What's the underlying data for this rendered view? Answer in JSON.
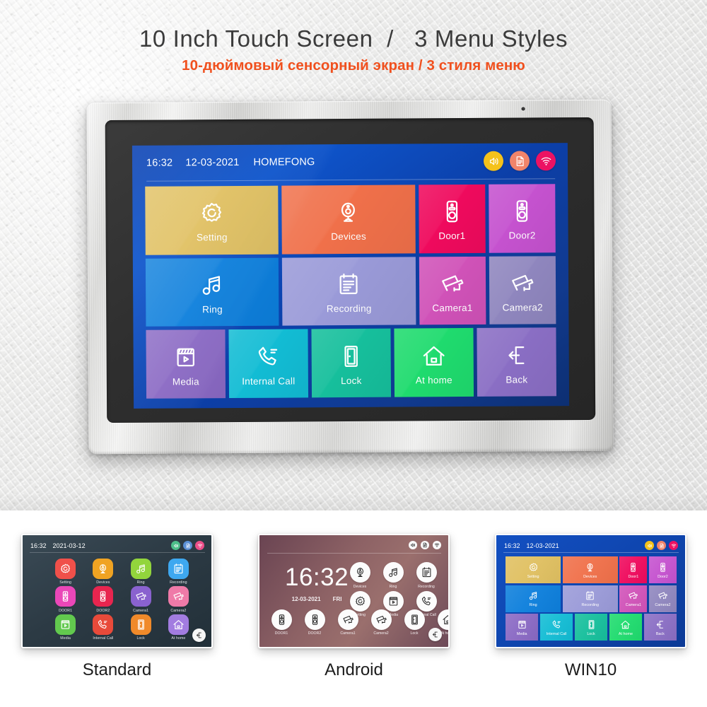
{
  "headline": {
    "english": "10 Inch Touch Screen  /   3 Menu Styles",
    "russian": "10-дюймовый сенсорный экран / 3 стиля меню",
    "english_color": "#3b3b3b",
    "russian_color": "#f0501e"
  },
  "main_screen": {
    "statusbar": {
      "time": "16:32",
      "date": "12-03-2021",
      "brand": "HOMEFONG",
      "icons": [
        {
          "name": "volume-icon",
          "color": "#f5c21b"
        },
        {
          "name": "document-icon",
          "color": "#f0846a"
        },
        {
          "name": "wifi-icon",
          "color": "#ec1263"
        }
      ]
    },
    "tiles": [
      {
        "label": "Setting",
        "icon": "gear-icon",
        "color": "#e0c061",
        "flex": 2
      },
      {
        "label": "Devices",
        "icon": "webcam-icon",
        "color": "#f0704a",
        "flex": 2
      },
      {
        "label": "Door1",
        "icon": "doorbell-icon",
        "color": "#ef0a5d",
        "flex": 1
      },
      {
        "label": "Door2",
        "icon": "doorbell-icon",
        "color": "#c552cf",
        "flex": 1
      },
      {
        "label": "Ring",
        "icon": "music-note-icon",
        "color": "#0d7fdc",
        "flex": 2
      },
      {
        "label": "Recording",
        "icon": "clipboard-icon",
        "color": "#9a9ad8",
        "flex": 2
      },
      {
        "label": "Camera1",
        "icon": "cctv-icon",
        "color": "#d052b8",
        "flex": 1
      },
      {
        "label": "Camera2",
        "icon": "cctv-icon",
        "color": "#8f86be",
        "flex": 1
      },
      {
        "label": "Media",
        "icon": "media-icon",
        "color": "#8a69c4",
        "flex": 1
      },
      {
        "label": "Internal Call",
        "icon": "phone-call-icon",
        "color": "#12bcd4",
        "flex": 1
      },
      {
        "label": "Lock",
        "icon": "door-icon",
        "color": "#16bf9c",
        "flex": 1
      },
      {
        "label": "At home",
        "icon": "home-icon",
        "color": "#1fdb6e",
        "flex": 1
      },
      {
        "label": "Back",
        "icon": "back-arrow-icon",
        "color": "#8a6ec4",
        "flex": 1
      }
    ]
  },
  "variants": [
    {
      "caption": "Standard",
      "statusbar": {
        "time": "16:32",
        "date": "2021-03-12"
      },
      "status_icons": [
        {
          "name": "volume-icon",
          "color": "#4dbf8a"
        },
        {
          "name": "document-icon",
          "color": "#5a8fd6"
        },
        {
          "name": "wifi-icon",
          "color": "#ec4e89"
        }
      ],
      "tiles": [
        {
          "label": "Setting",
          "icon": "gear-icon",
          "color": "#f0504a"
        },
        {
          "label": "Devices",
          "icon": "webcam-icon",
          "color": "#f0a322"
        },
        {
          "label": "Ring",
          "icon": "music-note-icon",
          "color": "#92d53c"
        },
        {
          "label": "Recording",
          "icon": "clipboard-icon",
          "color": "#3ea8f0"
        },
        {
          "label": "DOOR1",
          "icon": "doorbell-icon",
          "color": "#ea47b8"
        },
        {
          "label": "DOOR2",
          "icon": "doorbell-icon",
          "color": "#e8254f"
        },
        {
          "label": "Camera1",
          "icon": "cctv-icon",
          "color": "#8a62cf"
        },
        {
          "label": "Camera2",
          "icon": "cctv-icon",
          "color": "#ef7aa8"
        },
        {
          "label": "Media",
          "icon": "media-icon",
          "color": "#62c94e"
        },
        {
          "label": "Internal Call",
          "icon": "phone-call-icon",
          "color": "#e84a3a"
        },
        {
          "label": "Lock",
          "icon": "door-icon",
          "color": "#f08a2a"
        },
        {
          "label": "At home",
          "icon": "home-icon",
          "color": "#a27ce0"
        }
      ],
      "back_button": "back-arrow-icon"
    },
    {
      "caption": "Android",
      "clock": {
        "time": "16:32",
        "date": "12-03-2021",
        "weekday": "FRI"
      },
      "status_icons": [
        {
          "name": "volume-icon"
        },
        {
          "name": "document-icon"
        },
        {
          "name": "wifi-icon"
        }
      ],
      "tiles_right_row1": [
        {
          "label": "Devices",
          "icon": "webcam-icon"
        },
        {
          "label": "Ring",
          "icon": "music-note-icon"
        },
        {
          "label": "Recording",
          "icon": "clipboard-icon"
        }
      ],
      "tiles_right_row2": [
        {
          "label": "Setting",
          "icon": "gear-icon"
        },
        {
          "label": "Media",
          "icon": "media-icon"
        },
        {
          "label": "Internal Call",
          "icon": "phone-call-icon"
        }
      ],
      "tiles_bottom": [
        {
          "label": "DOOR1",
          "icon": "doorbell-icon"
        },
        {
          "label": "DOOR2",
          "icon": "doorbell-icon"
        },
        {
          "label": "Camera1",
          "icon": "cctv-icon"
        },
        {
          "label": "Camera2",
          "icon": "cctv-icon"
        },
        {
          "label": "Lock",
          "icon": "door-icon"
        },
        {
          "label": "At home",
          "icon": "home-icon"
        }
      ],
      "back_button": "back-arrow-icon"
    },
    {
      "caption": "WIN10",
      "statusbar": {
        "time": "16:32",
        "date": "12-03-2021"
      },
      "status_icons": [
        {
          "name": "volume-icon",
          "color": "#f5c21b"
        },
        {
          "name": "document-icon",
          "color": "#f0846a"
        },
        {
          "name": "wifi-icon",
          "color": "#ec1263"
        }
      ],
      "tiles": [
        {
          "label": "Setting",
          "icon": "gear-icon",
          "color": "#e0c061",
          "flex": 2
        },
        {
          "label": "Devices",
          "icon": "webcam-icon",
          "color": "#f0704a",
          "flex": 2
        },
        {
          "label": "Door1",
          "icon": "doorbell-icon",
          "color": "#ef0a5d",
          "flex": 1
        },
        {
          "label": "Door2",
          "icon": "doorbell-icon",
          "color": "#c552cf",
          "flex": 1
        },
        {
          "label": "Ring",
          "icon": "music-note-icon",
          "color": "#0d7fdc",
          "flex": 2
        },
        {
          "label": "Recording",
          "icon": "clipboard-icon",
          "color": "#9a9ad8",
          "flex": 2
        },
        {
          "label": "Camera1",
          "icon": "cctv-icon",
          "color": "#d052b8",
          "flex": 1
        },
        {
          "label": "Camera2",
          "icon": "cctv-icon",
          "color": "#8f86be",
          "flex": 1
        },
        {
          "label": "Media",
          "icon": "media-icon",
          "color": "#8a69c4",
          "flex": 1
        },
        {
          "label": "Internal Call",
          "icon": "phone-call-icon",
          "color": "#12bcd4",
          "flex": 1
        },
        {
          "label": "Lock",
          "icon": "door-icon",
          "color": "#16bf9c",
          "flex": 1
        },
        {
          "label": "At home",
          "icon": "home-icon",
          "color": "#1fdb6e",
          "flex": 1
        },
        {
          "label": "Back",
          "icon": "back-arrow-icon",
          "color": "#8a6ec4",
          "flex": 1
        }
      ]
    }
  ]
}
